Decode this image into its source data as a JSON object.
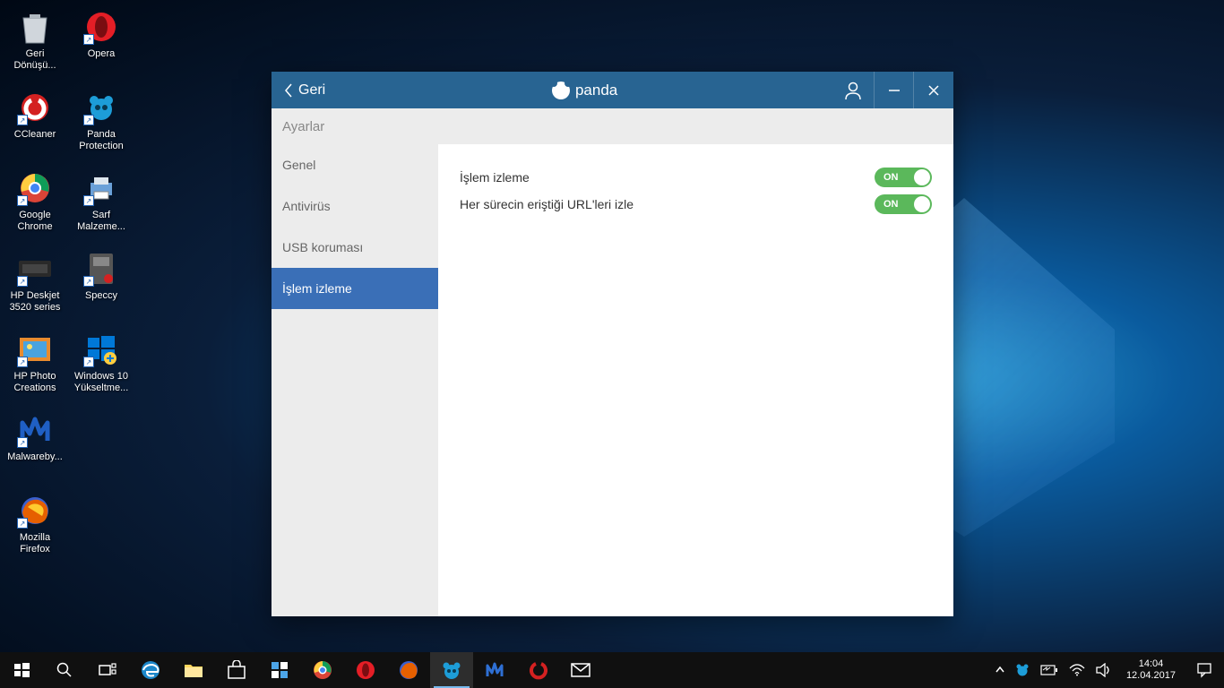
{
  "desktop": {
    "icons": [
      [
        {
          "label": "Geri Dönüşü...",
          "glyph": "recycle"
        },
        {
          "label": "Opera",
          "glyph": "opera"
        }
      ],
      [
        {
          "label": "CCleaner",
          "glyph": "ccleaner"
        },
        {
          "label": "Panda Protection",
          "glyph": "panda"
        }
      ],
      [
        {
          "label": "Google Chrome",
          "glyph": "chrome"
        },
        {
          "label": "Sarf Malzeme...",
          "glyph": "printer"
        }
      ],
      [
        {
          "label": "HP Deskjet 3520 series",
          "glyph": "device"
        },
        {
          "label": "Speccy",
          "glyph": "speccy"
        }
      ],
      [
        {
          "label": "HP Photo Creations",
          "glyph": "photo"
        },
        {
          "label": "Windows 10 Yükseltme...",
          "glyph": "win10"
        }
      ],
      [
        {
          "label": "Malwareby...",
          "glyph": "mbam"
        }
      ],
      [
        {
          "label": "Mozilla Firefox",
          "glyph": "firefox"
        }
      ]
    ]
  },
  "panda": {
    "back": "Geri",
    "brand": "panda",
    "subheader": "Ayarlar",
    "sidebar": [
      {
        "label": "Genel",
        "active": false
      },
      {
        "label": "Antivirüs",
        "active": false
      },
      {
        "label": "USB koruması",
        "active": false
      },
      {
        "label": "İşlem izleme",
        "active": true
      }
    ],
    "settings": [
      {
        "label": "İşlem izleme",
        "toggle": "ON"
      },
      {
        "label": "Her sürecin eriştiği URL'leri izle",
        "toggle": "ON"
      }
    ]
  },
  "taskbar": {
    "time": "14:04",
    "date": "12.04.2017"
  }
}
